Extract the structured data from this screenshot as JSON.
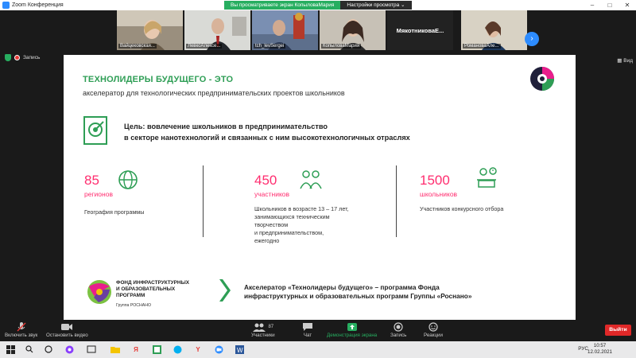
{
  "window": {
    "title": "Zoom Конференция"
  },
  "share_banner": {
    "status": "Вы просматриваете экран КопыловаМария",
    "options": "Настройки просмотра"
  },
  "gallery": {
    "participants": [
      {
        "name": "Вайцековская..."
      },
      {
        "name": "ЛевкоАлексе..."
      },
      {
        "name": "tch_levSergei"
      },
      {
        "name": "КопыловаМария"
      },
      {
        "name": "МякотниковаЕ..."
      },
      {
        "name": "РомановаАле..."
      }
    ]
  },
  "view_label": "Вид",
  "recording": "Запись",
  "slide": {
    "heading": "ТЕХНОЛИДЕРЫ БУДУЩЕГО - ЭТО",
    "subheading": "акселератор для технологических предпринимательских проектов  школьников",
    "goal_line1": "Цель: вовлечение школьников в предпринимательство",
    "goal_line2": "в секторе нанотехнологий и связанных с ним высокотехнологичных  отраслях",
    "stats": [
      {
        "number": "85",
        "unit": "регионов",
        "desc": [
          "География программы"
        ]
      },
      {
        "number": "450",
        "unit": "участников",
        "desc": [
          "Школьников в возрасте 13 – 17 лет,",
          "занимающихся техническим",
          "творчеством",
          "и предпринимательством,",
          "ежегодно"
        ]
      },
      {
        "number": "1500",
        "unit": "школьников",
        "desc": [
          "Участников конкурсного отбора"
        ]
      }
    ],
    "fond_name": [
      "ФОНД ИНФРАСТРУКТУРНЫХ",
      "И ОБРАЗОВАТЕЛЬНЫХ",
      "ПРОГРАММ"
    ],
    "fond_sub": "Группа РОСНАНО",
    "accel_line1": "Акселератор «Технолидеры будущего» – программа Фонда",
    "accel_line2": "инфраструктурных и образовательных программ Группы «Роснано»",
    "colors": {
      "green": "#2e9e55",
      "pink": "#ff2d6f"
    }
  },
  "meeting_controls": {
    "unmute": "Включить звук",
    "start_video": "Остановить видео",
    "participants": "Участники",
    "participants_count": "87",
    "chat": "Чат",
    "share": "Демонстрация экрана",
    "record": "Запись",
    "reactions": "Реакции",
    "leave": "Выйти"
  },
  "taskbar": {
    "lang": "РУС",
    "time": "10:57",
    "date": "12.02.2021"
  }
}
